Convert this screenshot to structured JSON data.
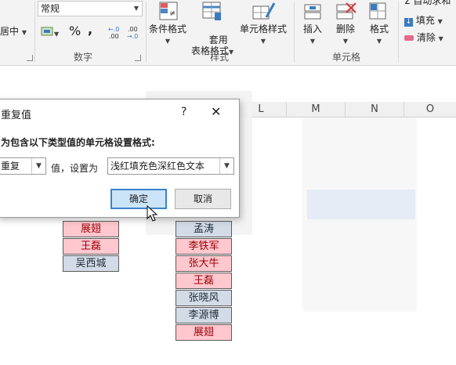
{
  "ribbon": {
    "alignment_partial": "居中",
    "number_format_value": "常规",
    "percent_symbol": "%",
    "comma_symbol": ",",
    "inc_decimal": "←.0\n.00",
    "dec_decimal": ".00\n→.0",
    "number_group_label": "数字",
    "conditional_format_label": "条件格式",
    "table_format_label": "套用\n表格格式",
    "cell_style_label": "单元格样式",
    "styles_group_label": "样式",
    "insert_label": "插入",
    "delete_label": "删除",
    "format_label": "格式",
    "cells_group_label": "单元格",
    "autosum_partial": "自动求和",
    "fill_label": "填充",
    "clear_label": "清除"
  },
  "columns": [
    "L",
    "M",
    "N",
    "O"
  ],
  "dialog": {
    "title": "重复值",
    "help": "?",
    "close": "✕",
    "prompt": "为包含以下类型值的单元格设置格式:",
    "type_value": "重复",
    "middle_text": "值，设置为",
    "style_value": "浅红填充色深红色文本",
    "ok_label": "确定",
    "cancel_label": "取消"
  },
  "left_list": [
    {
      "name": "展翅",
      "dup": true
    },
    {
      "name": "王磊",
      "dup": true
    },
    {
      "name": "吴西城",
      "dup": false
    }
  ],
  "right_list": [
    {
      "name": "孟涛",
      "dup": false
    },
    {
      "name": "李铁军",
      "dup": true
    },
    {
      "name": "张大牛",
      "dup": true
    },
    {
      "name": "王磊",
      "dup": true
    },
    {
      "name": "张晓风",
      "dup": false
    },
    {
      "name": "李源博",
      "dup": false
    },
    {
      "name": "展翅",
      "dup": true
    }
  ],
  "colors": {
    "dup_fill": "#ffc7ce",
    "dup_text": "#9c0006",
    "plain_fill": "#d3dbe6",
    "ok_border": "#3b83cf"
  }
}
